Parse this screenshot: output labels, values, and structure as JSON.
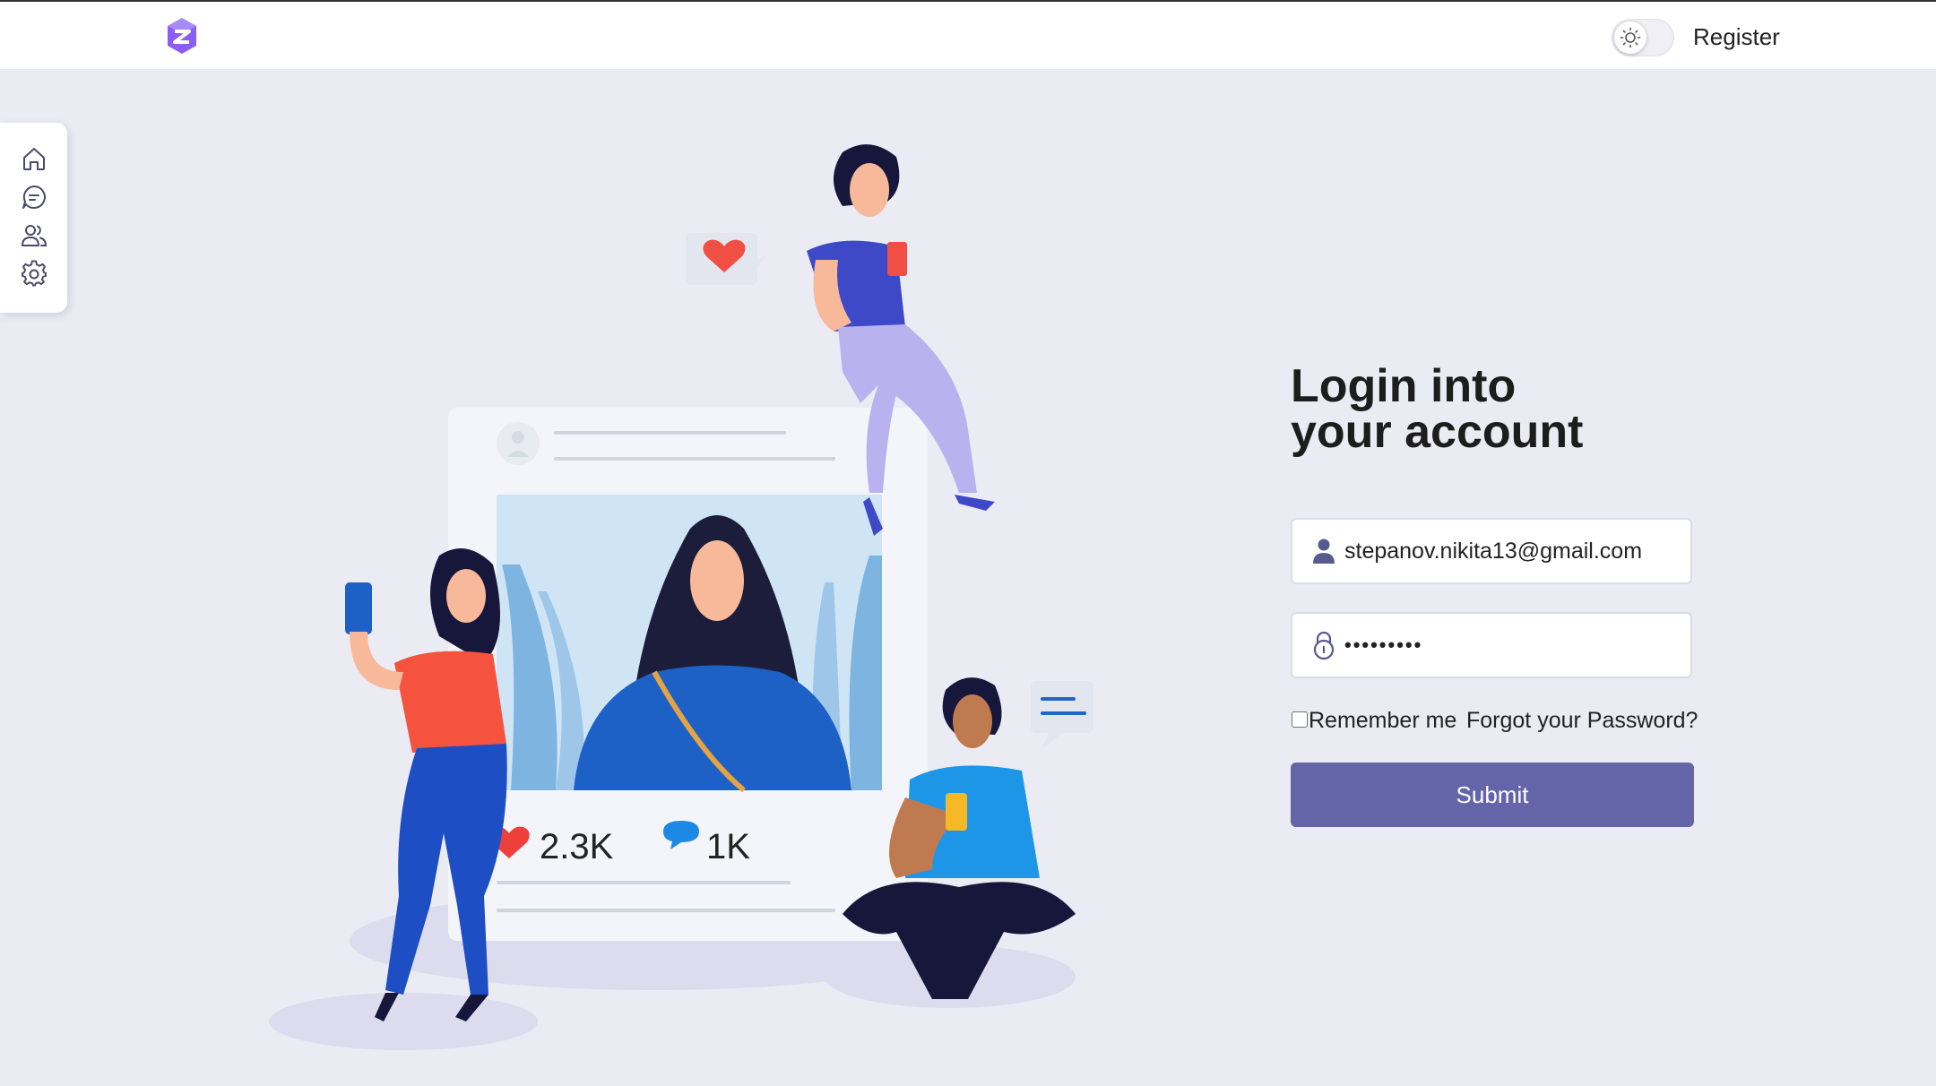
{
  "header": {
    "logo_icon": "hexagon-logo-icon",
    "theme_toggle_icon": "sun-icon",
    "register_label": "Register"
  },
  "sidebar": {
    "items": [
      {
        "name": "home",
        "icon": "home-icon"
      },
      {
        "name": "messages",
        "icon": "chat-icon"
      },
      {
        "name": "friends",
        "icon": "users-icon"
      },
      {
        "name": "settings",
        "icon": "gear-icon"
      }
    ]
  },
  "illustration": {
    "likes_count": "2.3K",
    "comments_count": "1K"
  },
  "login": {
    "title_line1": "Login into",
    "title_line2": "your account",
    "email_value": "stepanov.nikita13@gmail.com",
    "password_value": "qwerty123",
    "remember_label": "Remember me",
    "remember_checked": false,
    "forgot_label": "Forgot your Password?",
    "submit_label": "Submit"
  },
  "colors": {
    "accent": "#6465a8",
    "page_background": "#ebebf4",
    "logo": "#8b5cf6"
  }
}
